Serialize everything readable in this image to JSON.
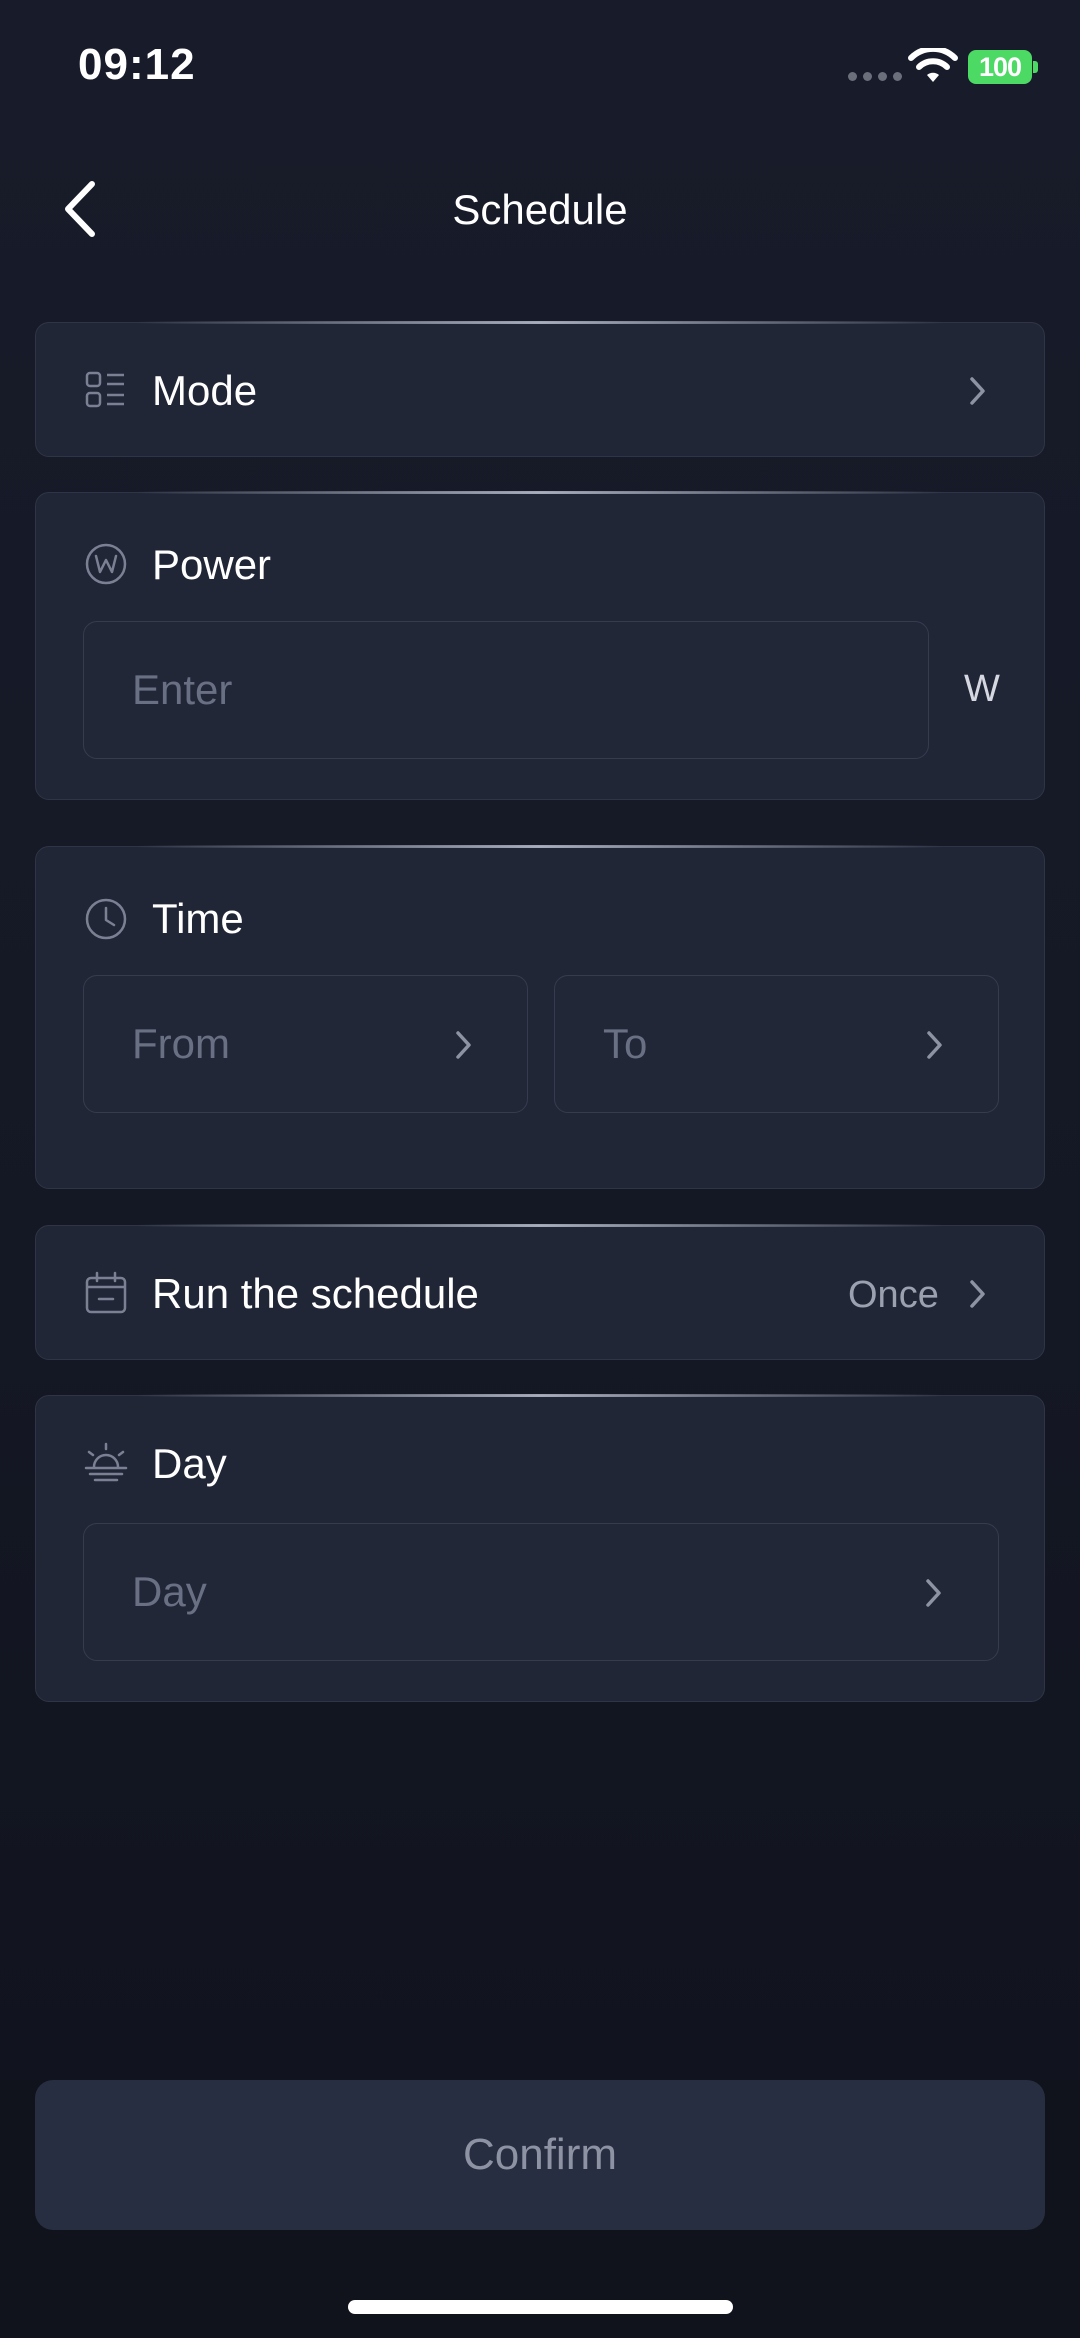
{
  "status_bar": {
    "time": "09:12",
    "battery": "100"
  },
  "header": {
    "title": "Schedule"
  },
  "mode": {
    "label": "Mode"
  },
  "power": {
    "label": "Power",
    "placeholder": "Enter",
    "unit": "W"
  },
  "time_section": {
    "label": "Time",
    "from_placeholder": "From",
    "to_placeholder": "To"
  },
  "run_schedule": {
    "label": "Run the schedule",
    "value": "Once"
  },
  "day": {
    "label": "Day",
    "placeholder": "Day"
  },
  "footer": {
    "confirm_label": "Confirm"
  }
}
